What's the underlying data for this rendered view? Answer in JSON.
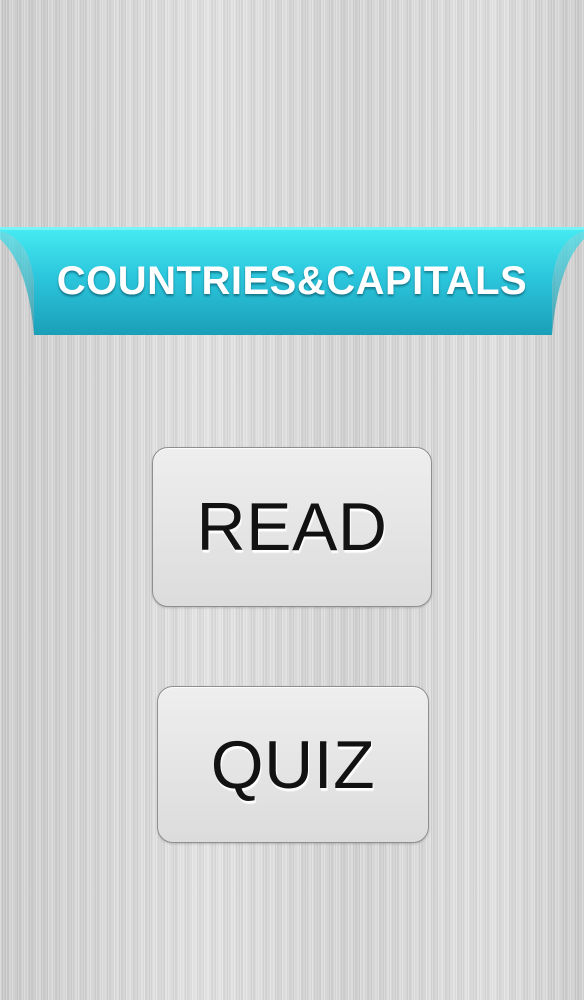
{
  "app": {
    "title": "COUNTRIES&CAPITALS"
  },
  "menu": {
    "read_label": "READ",
    "quiz_label": "QUIZ"
  },
  "colors": {
    "banner_top": "#46ecf3",
    "banner_bottom": "#1a9fb8",
    "background": "#d9d9d9",
    "button_face": "#e6e6e6",
    "button_border": "#8e8e8e",
    "button_text": "#121212"
  }
}
